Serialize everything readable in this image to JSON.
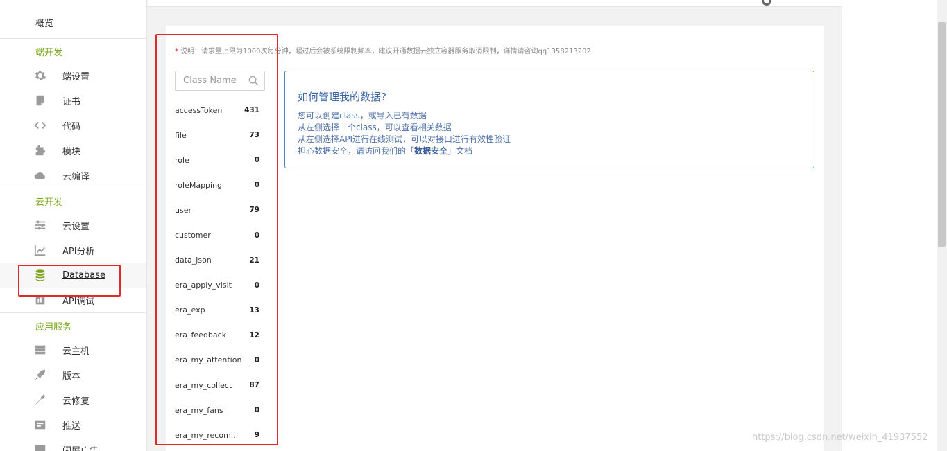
{
  "sidebar": {
    "overview": "概览",
    "sections": [
      {
        "title": "端开发",
        "items": [
          {
            "label": "端设置",
            "icon": "gear-icon"
          },
          {
            "label": "证书",
            "icon": "certificate-icon"
          },
          {
            "label": "代码",
            "icon": "code-icon"
          },
          {
            "label": "模块",
            "icon": "puzzle-icon"
          },
          {
            "label": "云编译",
            "icon": "cloud-icon"
          }
        ]
      },
      {
        "title": "云开发",
        "items": [
          {
            "label": "云设置",
            "icon": "sliders-icon"
          },
          {
            "label": "API分析",
            "icon": "chart-line-icon"
          },
          {
            "label": "Database",
            "icon": "database-icon",
            "active": true
          },
          {
            "label": "API调试",
            "icon": "debug-icon"
          }
        ]
      },
      {
        "title": "应用服务",
        "items": [
          {
            "label": "云主机",
            "icon": "server-icon"
          },
          {
            "label": "版本",
            "icon": "rocket-icon"
          },
          {
            "label": "云修复",
            "icon": "wrench-icon"
          },
          {
            "label": "推送",
            "icon": "push-icon"
          },
          {
            "label": "闪屏广告",
            "icon": "ad-icon"
          }
        ]
      }
    ]
  },
  "main": {
    "notice_star": "*",
    "notice": "说明：请求量上限为1000次每分钟，超过后会被系统限制频率，建议开通数据云独立容器服务取消限制，详情请咨询qq1358213202",
    "search": {
      "placeholder": "Class Name",
      "icon": "search-icon"
    },
    "classes": [
      {
        "name": "accessToken",
        "count": "431"
      },
      {
        "name": "file",
        "count": "73"
      },
      {
        "name": "role",
        "count": "0"
      },
      {
        "name": "roleMapping",
        "count": "0"
      },
      {
        "name": "user",
        "count": "79"
      },
      {
        "name": "customer",
        "count": "0"
      },
      {
        "name": "data_json",
        "count": "21"
      },
      {
        "name": "era_apply_visit",
        "count": "0"
      },
      {
        "name": "era_exp",
        "count": "13"
      },
      {
        "name": "era_feedback",
        "count": "12"
      },
      {
        "name": "era_my_attention",
        "count": "0"
      },
      {
        "name": "era_my_collect",
        "count": "87"
      },
      {
        "name": "era_my_fans",
        "count": "0"
      },
      {
        "name": "era_my_recom...",
        "count": "9"
      }
    ],
    "info": {
      "title": "如何管理我的数据?",
      "line1": "您可以创建class，或导入已有数据",
      "line2": "从左侧选择一个class，可以查看相关数据",
      "line3": "从左侧选择API进行在线测试，可以对接口进行有效性验证",
      "line4_prefix": "担心数据安全，请访问我们的「",
      "line4_link": "数据安全",
      "line4_suffix": "」文档"
    }
  },
  "watermark": "https://blog.csdn.net/weixin_41937552",
  "colors": {
    "accent_green": "#79a81a",
    "link_blue": "#3a66a8",
    "highlight_red": "#e02a2a"
  }
}
